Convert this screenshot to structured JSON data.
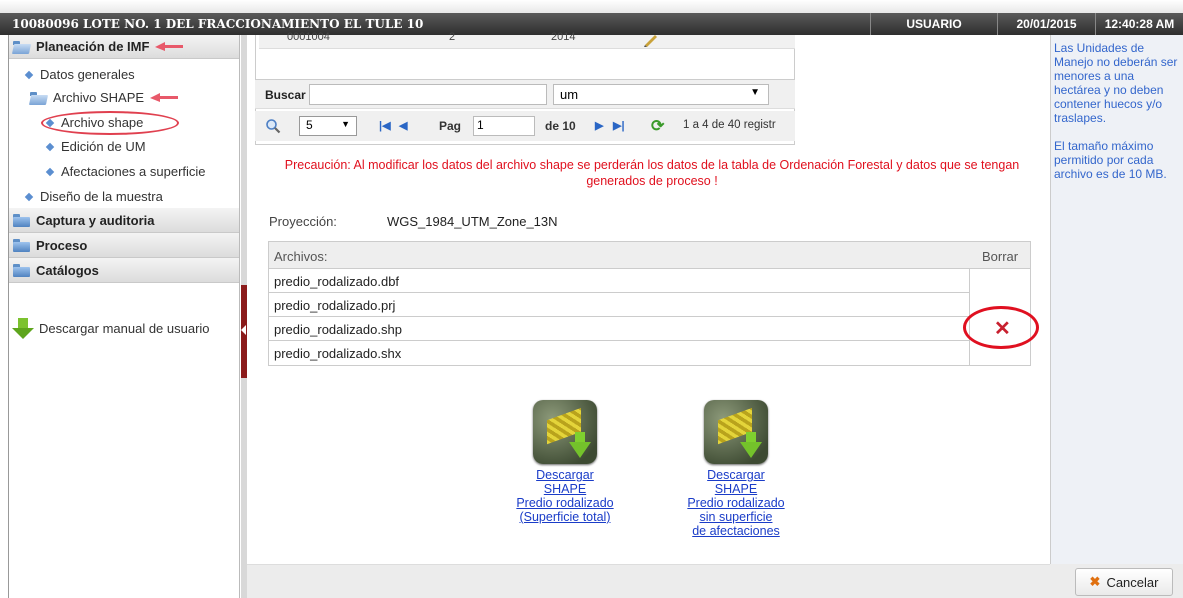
{
  "titlebar": {
    "title": "10080096 LOTE NO. 1 DEL FRACCIONAMIENTO EL TULE 10",
    "user": "USUARIO",
    "date": "20/01/2015",
    "time": "12:40:28 AM"
  },
  "sidebar": {
    "sections": [
      {
        "label": "Planeación de IMF"
      },
      {
        "label": "Captura y auditoria"
      },
      {
        "label": "Proceso"
      },
      {
        "label": "Catálogos"
      }
    ],
    "items": {
      "datos_generales": "Datos generales",
      "archivo_shape_group": "Archivo SHAPE",
      "archivo_shape": "Archivo shape",
      "edicion_um": "Edición de UM",
      "afectaciones": "Afectaciones a superficie",
      "diseno_muestra": "Diseño de la muestra"
    },
    "download_manual": "Descargar manual de usuario"
  },
  "grid_partial": {
    "col1": "0001004",
    "col2": "2",
    "col3": "2014"
  },
  "search": {
    "label": "Buscar",
    "value": "",
    "select_value": "um"
  },
  "pager": {
    "page_size": "5",
    "page_label": "Pag",
    "page_value": "1",
    "of_label": "de 10",
    "records": "1 a 4 de 40 registr"
  },
  "warning": "Precaución: Al modificar los datos del archivo shape se perderán los datos de la tabla de Ordenación Forestal y datos que se tengan generados de proceso !",
  "projection": {
    "label": "Proyección:",
    "value": "WGS_1984_UTM_Zone_13N"
  },
  "files": {
    "header_files": "Archivos:",
    "header_delete": "Borrar",
    "rows": [
      "predio_rodalizado.dbf",
      "predio_rodalizado.prj",
      "predio_rodalizado.shp",
      "predio_rodalizado.shx"
    ]
  },
  "downloads": {
    "total": [
      "Descargar",
      "SHAPE",
      "Predio rodalizado",
      "(Superficie total)"
    ],
    "sin_afectaciones": [
      "Descargar",
      "SHAPE",
      "Predio rodalizado",
      "sin superficie",
      "de afectaciones"
    ]
  },
  "info": {
    "p1": "Las Unidades de Manejo no deberán ser menores a una hectárea y no deben contener huecos y/o traslapes.",
    "p2": "El tamaño máximo permitido por cada archivo es de 10 MB."
  },
  "cancel_label": "Cancelar",
  "colors": {
    "accent": "#3366cc",
    "warning": "#e0101e",
    "annotation": "#e0404f"
  }
}
